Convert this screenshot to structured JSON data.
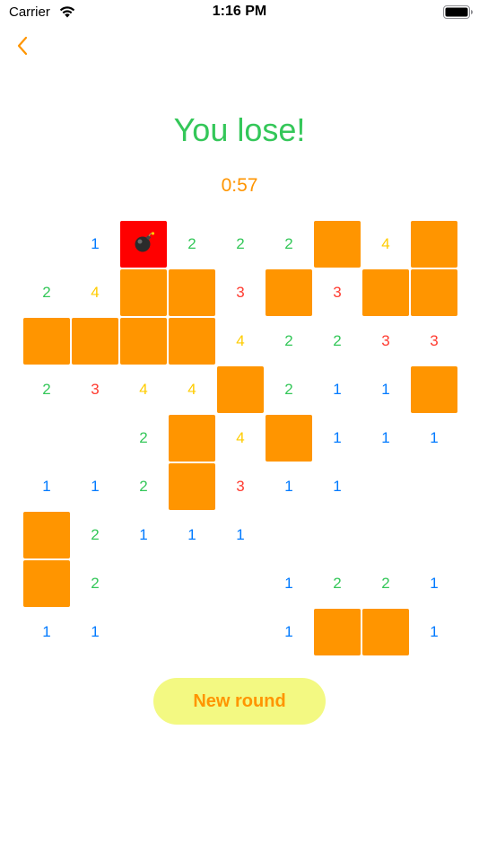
{
  "status_bar": {
    "carrier": "Carrier",
    "time": "1:16 PM"
  },
  "nav": {
    "back_icon": "chevron-left-icon",
    "accent_color": "#ff9500"
  },
  "game": {
    "title": "You lose!",
    "timer": "0:57",
    "new_round_label": "New round",
    "colors": {
      "covered": "#ff9500",
      "mine": "#ff0000",
      "title": "#34c759",
      "n1": "#007aff",
      "n2": "#34c759",
      "n3": "#ff3b30",
      "n4": "#ffcc00"
    },
    "board": [
      [
        "",
        "1",
        "M",
        "2",
        "2",
        "2",
        "C",
        "4",
        "C"
      ],
      [
        "2",
        "4",
        "C",
        "C",
        "3",
        "C",
        "3",
        "C",
        "C"
      ],
      [
        "C",
        "C",
        "C",
        "C",
        "4",
        "2",
        "2",
        "3",
        "3"
      ],
      [
        "2",
        "3",
        "4",
        "4",
        "C",
        "2",
        "1",
        "1",
        "C"
      ],
      [
        "",
        "",
        "2",
        "C",
        "4",
        "C",
        "1",
        "1",
        "1"
      ],
      [
        "1",
        "1",
        "2",
        "C",
        "3",
        "1",
        "1",
        "",
        ""
      ],
      [
        "C",
        "2",
        "1",
        "1",
        "1",
        "",
        "",
        "",
        ""
      ],
      [
        "C",
        "2",
        "",
        "",
        "",
        "1",
        "2",
        "2",
        "1"
      ],
      [
        "1",
        "1",
        "",
        "",
        "",
        "1",
        "C",
        "C",
        "1"
      ]
    ]
  }
}
